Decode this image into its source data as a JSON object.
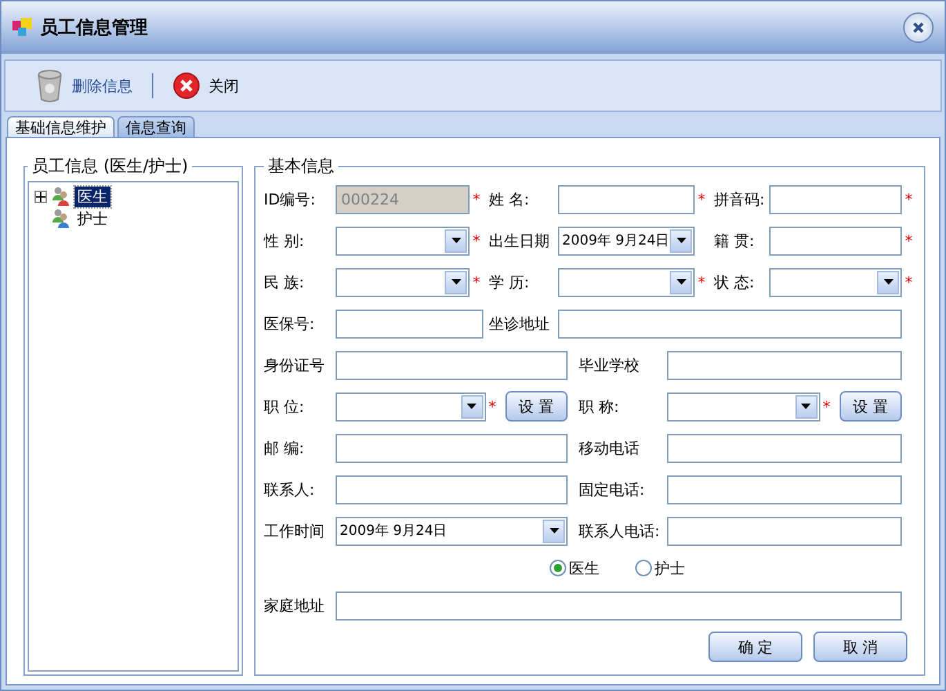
{
  "window": {
    "title": "员工信息管理"
  },
  "toolbar": [
    {
      "label": "删除信息",
      "kind": "delete"
    },
    {
      "label": "关闭",
      "kind": "close"
    }
  ],
  "tabs": [
    {
      "label": "基础信息维护",
      "selected": true
    },
    {
      "label": "信息查询",
      "selected": false
    }
  ],
  "tree": {
    "title": "员工信息 (医生/护士)",
    "items": [
      {
        "label": "医生",
        "selected": true,
        "expander": true,
        "kind": "doctor"
      },
      {
        "label": "护士",
        "selected": false,
        "expander": false,
        "kind": "nurse"
      }
    ]
  },
  "form": {
    "title": "基本信息",
    "rows": [
      {
        "kind": "triple",
        "fields": [
          {
            "label": "ID编号:",
            "kind": "input",
            "value": "000224",
            "disabled": true,
            "mark": "*"
          },
          {
            "label": "姓 名:",
            "kind": "input",
            "disabled": false,
            "mark": "*"
          },
          {
            "label": "拼音码:",
            "kind": "input",
            "disabled": false,
            "mark": "*"
          }
        ]
      },
      {
        "kind": "triple",
        "fields": [
          {
            "label": "性 别:",
            "kind": "select",
            "mark": "*"
          },
          {
            "label": "出生日期",
            "kind": "date",
            "value": "2009年 9月24日"
          },
          {
            "label": "籍 贯:",
            "kind": "input",
            "disabled": false,
            "mark": "*"
          }
        ]
      },
      {
        "kind": "triple",
        "fields": [
          {
            "label": "民 族:",
            "kind": "select",
            "mark": "*"
          },
          {
            "label": "学 历:",
            "kind": "select",
            "mark": "*"
          },
          {
            "label": "状 态:",
            "kind": "select",
            "mark": "*"
          }
        ]
      },
      {
        "kind": "mixed",
        "fields": [
          {
            "label": "医保号:",
            "kind": "input",
            "disabled": false
          },
          {
            "label": "坐诊地址",
            "kind": "input",
            "disabled": false
          }
        ]
      },
      {
        "kind": "pair",
        "fields": [
          {
            "label": "身份证号",
            "kind": "input",
            "disabled": false
          },
          {
            "label": "毕业学校",
            "kind": "input",
            "disabled": false
          }
        ]
      },
      {
        "kind": "pair",
        "fields": [
          {
            "label": "职 位:",
            "kind": "select",
            "mark": "*",
            "button": "设 置"
          },
          {
            "label": "职 称:",
            "kind": "select",
            "mark": "*",
            "button": "设 置"
          }
        ]
      },
      {
        "kind": "pair",
        "fields": [
          {
            "label": "邮 编:",
            "kind": "input",
            "disabled": false
          },
          {
            "label": "移动电话",
            "kind": "input",
            "disabled": false
          }
        ]
      },
      {
        "kind": "pair",
        "fields": [
          {
            "label": "联系人:",
            "kind": "input",
            "disabled": false
          },
          {
            "label": "固定电话:",
            "kind": "input",
            "disabled": false
          }
        ]
      },
      {
        "kind": "pair",
        "fields": [
          {
            "label": "工作时间",
            "kind": "date",
            "value": "2009年 9月24日"
          },
          {
            "label": "联系人电话:",
            "kind": "input",
            "disabled": false
          }
        ]
      },
      {
        "kind": "radios",
        "options": [
          {
            "label": "医生",
            "selected": true
          },
          {
            "label": "护士",
            "selected": false
          }
        ]
      },
      {
        "kind": "wide",
        "fields": [
          {
            "label": "家庭地址",
            "kind": "input",
            "disabled": false
          }
        ]
      }
    ],
    "buttons": [
      {
        "label": "确 定"
      },
      {
        "label": "取 消"
      }
    ]
  }
}
